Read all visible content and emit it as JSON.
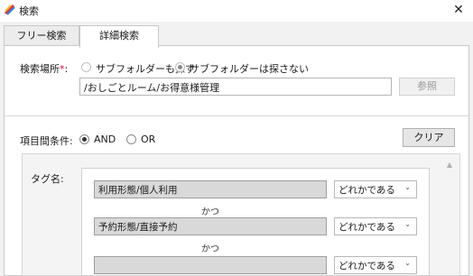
{
  "window": {
    "title": "検索",
    "close": "✕",
    "icon": "app-icon"
  },
  "tabs": [
    {
      "label": "フリー検索",
      "active": false
    },
    {
      "label": "詳細検索",
      "active": true
    }
  ],
  "location": {
    "label": "検索場所",
    "required_mark": "*",
    "colon": ":",
    "options": [
      {
        "label": "サブフォルダーも探す",
        "selected": false
      },
      {
        "label": "サブフォルダーは探さない",
        "selected": true
      }
    ],
    "path": "/おしごとルーム/お得意様管理",
    "browse_button": "参照"
  },
  "condition": {
    "label": "項目間条件:",
    "options": [
      {
        "label": "AND",
        "selected": true
      },
      {
        "label": "OR",
        "selected": false
      }
    ],
    "clear_button": "クリア"
  },
  "tags": {
    "label": "タグ名:",
    "rows": [
      {
        "value": "利用形態/個人利用",
        "match": "どれかである"
      },
      {
        "value": "予約形態/直接予約",
        "match": "どれかである"
      },
      {
        "value": "",
        "match": "どれかである"
      }
    ],
    "connector": "かつ"
  }
}
